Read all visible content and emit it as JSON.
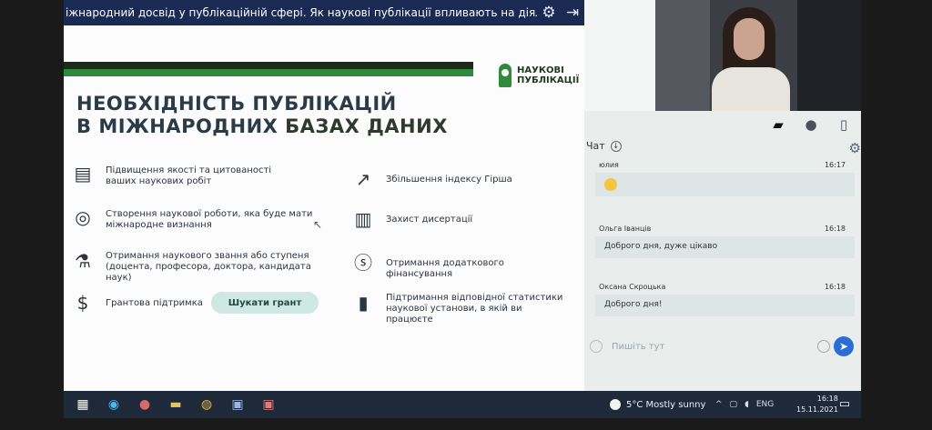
{
  "topbar": {
    "title": "іжнародний досвід у публікаційній сфері. Як наукові публікації впливають на діяльність вч...",
    "settings_icon": "gear-icon",
    "exit_icon": "exit-icon"
  },
  "slide": {
    "logo_line1": "НАУКОВІ",
    "logo_line2": "ПУБЛІКАЦІЇ",
    "title_line1": "НЕОБХІДНІСТЬ ПУБЛІКАЦІЙ",
    "title_line2_a": "В МІЖНАРОДНИХ ",
    "title_line2_b": "БАЗАХ ДАНИХ",
    "items_left": [
      {
        "icon": "document-icon",
        "text": "Підвищення якості та цитованості ваших наукових робіт"
      },
      {
        "icon": "globe-icon",
        "text": "Створення наукової роботи, яка буде мати міжнародне визнання"
      },
      {
        "icon": "microscope-icon",
        "text": "Отримання наукового звання або ступеня (доцента, професора, доктора, кандидата наук)"
      },
      {
        "icon": "money-hand-icon",
        "text": "Грантова підтримка"
      }
    ],
    "items_right": [
      {
        "icon": "trend-up-icon",
        "text": "Збільшення індексу Гірша"
      },
      {
        "icon": "thesis-book-icon",
        "text": "Захист дисертації"
      },
      {
        "icon": "dollar-icon",
        "text": "Отримання додаткового фінансування"
      },
      {
        "icon": "bar-chart-icon",
        "text": "Підтримання відповідної статистики наукової установи, в якій ви працюєте"
      }
    ],
    "grant_button": "Шукати грант"
  },
  "chat": {
    "label": "Чат",
    "messages": [
      {
        "author": "юлия",
        "time": "16:17",
        "text": ""
      },
      {
        "author": "Ольга Іванців",
        "time": "16:18",
        "text": "Доброго дня, дуже цікаво"
      },
      {
        "author": "Оксана Скроцька",
        "time": "16:18",
        "text": "Доброго дня!"
      }
    ],
    "input_placeholder": "Пишіть тут"
  },
  "taskbar": {
    "weather": "5°C  Mostly sunny",
    "lang": "ENG",
    "time": "16:18",
    "date": "15.11.2021"
  }
}
